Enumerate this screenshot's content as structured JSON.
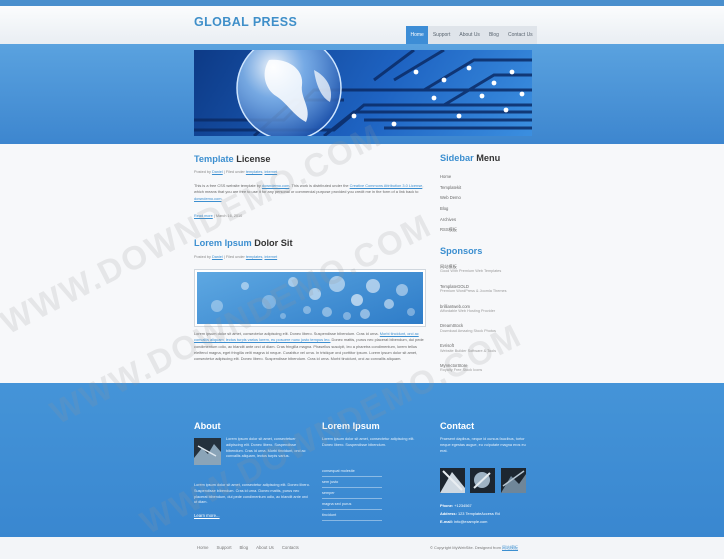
{
  "header": {
    "logo": "GLOBAL PRESS",
    "nav": [
      "Home",
      "Support",
      "About Us",
      "Blog",
      "Contact Us"
    ],
    "active_nav": "Home"
  },
  "post1": {
    "title_highlight": "Template",
    "title_rest": " License",
    "meta_prefix": "Posted by ",
    "meta_author": "Daniel",
    "meta_mid": " | Filed under ",
    "meta_cat1": "templates",
    "meta_sep": ", ",
    "meta_cat2": "internet",
    "body_a": "This is a free CSS website template by ",
    "body_link1": "downdemo.com",
    "body_b": ". This work is distributed under the ",
    "body_link2": "Creative Commons Attribution 3.0 License",
    "body_c": ", which means that you are free to use it for any personal or commercial purpose provided you credit me in the form of a link back to ",
    "body_link3": "downdemo.com",
    "body_d": ".",
    "read_more": "Read more",
    "date": " | March 16, 2010"
  },
  "post2": {
    "title_highlight": "Lorem Ipsum",
    "title_rest": " Dolor Sit",
    "meta_prefix": "Posted by ",
    "meta_author": "Daniel",
    "meta_mid": " | Filed under ",
    "meta_cat1": "templates",
    "meta_sep": ", ",
    "meta_cat2": "internet",
    "body_a": "Lorem ipsum dolor sit amet, consectetur adipiscing elit. Donec libero. Suspendisse bibendum. Cras id urna. ",
    "body_link1": "Morbi tincidunt, orci ac convallis aliquam, lectus turpis varius lorem, eu posuere nunc justo tempus leo.",
    "body_b": " Donec mattis, purus nec placerat bibendum, dui pede condimentum odio, ac blandit ante orci ut diam. Cras fringilla magna. Phasellus suscipit, leo a pharetra condimentum, lorem tellus eleifend magna, eget fringilla velit magna id neque. Curabitur vel urna. In tristique orci porttitor ipsum. Lorem ipsum dolor sit amet, consectetur adipiscing elit. Donec libero. Suspendisse bibendum. Cras id urna. Morbi tincidunt, orci ac convallis aliquam.",
    "read_more": "Read more",
    "date": " | March 17, 2010"
  },
  "sidebar": {
    "menu_title_highlight": "Sidebar",
    "menu_title_rest": " Menu",
    "menu_items": [
      "Home",
      "Templatekit",
      "Web Demo",
      "Blog",
      "Archives",
      "RSS模板"
    ],
    "sponsors_title": "Sponsors",
    "sponsors": [
      {
        "name": "网站模板",
        "desc": "Good With Premium Web Templates"
      },
      {
        "name": "TemplateGOLD",
        "desc": "Premium WordPress & Joomla Themes"
      },
      {
        "name": "brilliantweb.com",
        "desc": "Affordable Web Hosting Provider"
      },
      {
        "name": "DreamStock",
        "desc": "Download Amazing Stock Photos"
      },
      {
        "name": "Evrisoft",
        "desc": "Website Builder Software & Tools"
      },
      {
        "name": "MyVectorStore",
        "desc": "Royalty Free Stock Icons"
      }
    ]
  },
  "footer": {
    "about_title": "About",
    "about_side_text": "Lorem ipsum dolor sit amet, consectetuer adipiscing elit. Donec libero. Suspendisse bibendum. Cras id urna. Morbi tincidunt, orci ac convallis aliquam, lectus turpis varius.",
    "about_text": "Lorem ipsum dolor sit amet, consectetur adipiscing elit. Donec libero. Suspendisse bibendum. Cras id urna. Donec mattis, purus nec placerat bibendum, dui pede condimentum odio, ac blandit ante orci ut diam.",
    "about_link": "Learn more...",
    "lorem_title": "Lorem Ipsum",
    "lorem_text": "Lorem ipsum dolor sit amet, consectetur adipiscing elit. Donec libero. Suspendisse bibendum.",
    "lorem_list": [
      "consequat molestie",
      "sem justo",
      "semper",
      "magna sed purus",
      "tincidunt"
    ],
    "contact_title": "Contact",
    "contact_text": "Praesent dapibus, neque id cursus faucibus, tortor neque egestas augue, eu vulputate magna eros eu erat.",
    "phone_label": "Phone:",
    "phone_value": " +1234567",
    "address_label": "Address:",
    "address_value": " 123 TemplateAccess Rd",
    "email_label": "E-mail:",
    "email_value": " info@example.com"
  },
  "bottom": {
    "nav": [
      "Home",
      "Support",
      "Blog",
      "About Us",
      "Contacts"
    ],
    "copyright_text": "© Copyright MyWebSite. Designed from ",
    "copyright_link": "网站模板"
  },
  "watermark_text": "WWW.DOWNDEMO.COM",
  "colors": {
    "accent": "#3c8fd0",
    "footer_bg": "#3f8fd4",
    "nav_active": "#3d8dd6"
  }
}
